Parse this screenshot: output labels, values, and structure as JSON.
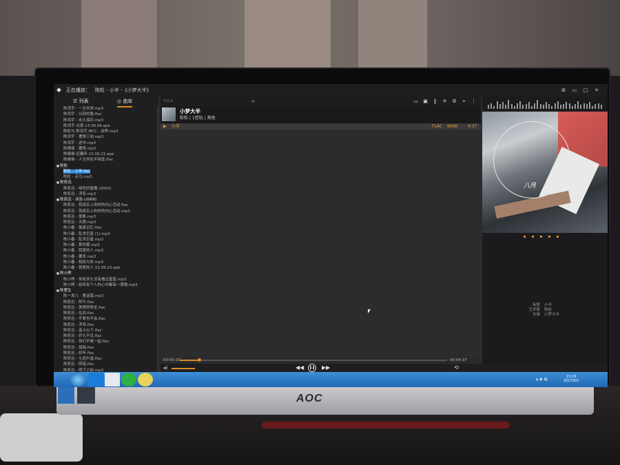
{
  "window": {
    "now_playing_label": "正在播放：",
    "now_playing_track": "陈粒 - 小半 -《小梦大半》",
    "controls": [
      "⊞",
      "▭",
      "□",
      "✕"
    ]
  },
  "left_panel": {
    "tabs": [
      {
        "label": "列表",
        "icon": "list-icon"
      },
      {
        "label": "曲库",
        "icon": "library-icon",
        "active": true
      }
    ],
    "rows": [
      {
        "text": "陈鸿宇 - 一生何求.mp3"
      },
      {
        "text": "陈鸿宇 - 分别的路.flac"
      },
      {
        "text": "陈鸿宇 - 永久保存.mp3"
      },
      {
        "text": "陈鸿宇-光豪.13.08.09.ape"
      },
      {
        "text": "陈粒与 陈鸿宇.MCC - 战争.mp3"
      },
      {
        "text": "陈鸿宇 - 理想三旬.mp3"
      },
      {
        "text": "陈鸿宇 - 途中.mp3"
      },
      {
        "text": "陈婧霏 - 魔怪.mp3"
      },
      {
        "text": "陈婧霏-迟暮年.13.09.21.ape"
      },
      {
        "text": "陈婧霏 - 人生何处不相逢.flac"
      },
      {
        "text": "陈粒",
        "folder": true
      },
      {
        "text": "陈粒 - 小半.flac",
        "selected": true
      },
      {
        "text": "陈粒 - 走马.mp3"
      },
      {
        "text": "陈奕迅",
        "folder": true
      },
      {
        "text": "陈奕迅 - 绿色的屋檐 (2003)"
      },
      {
        "text": "陈奕迅 - 浮夸.mp3"
      },
      {
        "text": "陈奕迅 - 沐浴 (2009)",
        "folder": true
      },
      {
        "text": "陈奕迅 - 我真实上你时的内心活动.flac"
      },
      {
        "text": "陈奕迅 - 我真实上你时的内心活动.mp3"
      },
      {
        "text": "陈奕迅 - 爱断.mp3"
      },
      {
        "text": "陈奕迅 - 天照.mp3"
      },
      {
        "text": "陈小春 - 独家记忆.flac"
      },
      {
        "text": "陈小春 - 乱世巨星 (1).mp3"
      },
      {
        "text": "陈小春 - 乱世巨星.mp3"
      },
      {
        "text": "陈小春 - 算你狠.mp3"
      },
      {
        "text": "陈小春 - 我爱的人.mp3"
      },
      {
        "text": "陈小春 - 要发.mp3"
      },
      {
        "text": "陈小春 - 相依为命.mp3"
      },
      {
        "text": "陈小春 - 我爱的人.13.09.23.ape"
      },
      {
        "text": "陈小熊",
        "folder": true
      },
      {
        "text": "陈小熊 - 你有多久没有看过星星.mp3"
      },
      {
        "text": "陈小熊 - 给所有个人的心中都有一首歌.mp3"
      },
      {
        "text": "陈楚生",
        "folder": true
      },
      {
        "text": "陈一发儿 - 童话镇.mp3"
      },
      {
        "text": "陈奕迅 - 阿牛.flac"
      },
      {
        "text": "陈奕迅 - 爱情转移至.flac"
      },
      {
        "text": "陈奕迅 - 在间.flac"
      },
      {
        "text": "陈奕迅 - 不爱也不会.flac"
      },
      {
        "text": "陈奕迅 - 浮夸.flac"
      },
      {
        "text": "陈奕迅 - 富士山下.flac"
      },
      {
        "text": "陈奕迅 - 好久不见.flac"
      },
      {
        "text": "陈奕迅 - 你们不是一起.flac"
      },
      {
        "text": "陈奕迅 - 孤独.flac"
      },
      {
        "text": "陈奕迅 - 好年.flac"
      },
      {
        "text": "陈奕迅 - 七若尔温.flac"
      },
      {
        "text": "陈奕迅 - 阴暗.flac"
      },
      {
        "text": "陈奕迅 - 明下之前.mp3"
      }
    ]
  },
  "middle": {
    "search_placeholder": "Ysca",
    "tool_icons": [
      "folder-icon",
      "save-icon",
      "equalizer-icon",
      "shuffle-icon",
      "loop-icon",
      "target-icon",
      "settings-icon",
      "more-icon"
    ],
    "album_title": "小梦大半",
    "album_sub": "陈粒 | 1音轨 | 其他",
    "track": {
      "name": "小半",
      "format": "FLAC",
      "bitrate": "869K",
      "duration": "4:37"
    },
    "progress": {
      "elapsed": "00:00:20",
      "total": "00:04:37",
      "fraction": 0.072
    }
  },
  "right_panel": {
    "cover_text": "八月",
    "meta": [
      {
        "k": "标题",
        "v": "小半"
      },
      {
        "k": "艺术家",
        "v": "陈粒"
      },
      {
        "k": "专辑",
        "v": "小梦大半"
      }
    ],
    "viz_levels": [
      0.4,
      0.6,
      0.3,
      0.8,
      0.5,
      0.7,
      0.4,
      0.9,
      0.5,
      0.3,
      0.6,
      0.8,
      0.4,
      0.5,
      0.7,
      0.3,
      0.6,
      0.9,
      0.5,
      0.4,
      0.7,
      0.5,
      0.3,
      0.6,
      0.8,
      0.4,
      0.5,
      0.7,
      0.6,
      0.3,
      0.5,
      0.8,
      0.4,
      0.6,
      0.5,
      0.7,
      0.3,
      0.5,
      0.6,
      0.4
    ]
  },
  "taskbar": {
    "time": "15:19",
    "date": "2017/6/1"
  },
  "monitor": {
    "brand": "AOC"
  }
}
